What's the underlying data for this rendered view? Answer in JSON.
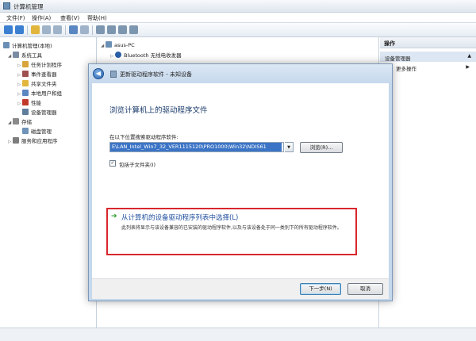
{
  "window": {
    "title": "计算机管理"
  },
  "menu": [
    "文件(F)",
    "操作(A)",
    "查看(V)",
    "帮助(H)"
  ],
  "tree": [
    {
      "label": "计算机管理(本地)",
      "indent": 0,
      "exp": "",
      "icon": "computer-icon",
      "color": "#6a8fb5"
    },
    {
      "label": "系统工具",
      "indent": 1,
      "exp": "◢",
      "icon": "tools-icon",
      "color": "#7b8da3"
    },
    {
      "label": "任务计划程序",
      "indent": 2,
      "exp": "▷",
      "icon": "clock-icon",
      "color": "#d9a43a"
    },
    {
      "label": "事件查看器",
      "indent": 2,
      "exp": "▷",
      "icon": "event-icon",
      "color": "#a05050"
    },
    {
      "label": "共享文件夹",
      "indent": 2,
      "exp": "▷",
      "icon": "folder-icon",
      "color": "#e2b63c"
    },
    {
      "label": "本地用户和组",
      "indent": 2,
      "exp": "▷",
      "icon": "users-icon",
      "color": "#5a86c1"
    },
    {
      "label": "性能",
      "indent": 2,
      "exp": "▷",
      "icon": "performance-icon",
      "color": "#c0392b"
    },
    {
      "label": "设备管理器",
      "indent": 2,
      "exp": "",
      "icon": "device-manager-icon",
      "color": "#607d9c"
    },
    {
      "label": "存储",
      "indent": 1,
      "exp": "◢",
      "icon": "storage-icon",
      "color": "#8a8a8a"
    },
    {
      "label": "磁盘管理",
      "indent": 2,
      "exp": "",
      "icon": "disk-icon",
      "color": "#6f93b9"
    },
    {
      "label": "服务和应用程序",
      "indent": 1,
      "exp": "▷",
      "icon": "services-icon",
      "color": "#7d7d7d"
    }
  ],
  "device_tree": [
    {
      "label": "asus-PC",
      "indent": 0,
      "exp": "◢",
      "icon": "computer-icon",
      "color": "#6a8fb5"
    },
    {
      "label": "Bluetooth 无线电收发器",
      "indent": 1,
      "exp": "▷",
      "icon": "bluetooth-icon",
      "color": "#2b5fa8"
    }
  ],
  "actions": {
    "header": "操作",
    "selected": "设备管理器",
    "more": "更多操作"
  },
  "dialog": {
    "title": "更新驱动程序软件 - 未知设备",
    "heading": "浏览计算机上的驱动程序文件",
    "search_label": "在以下位置搜索驱动程序软件:",
    "path": "E\\LAN_Intel_Win7_32_VER1115120\\PRO1000\\Win32\\NDIS61",
    "browse": "浏览(R)...",
    "include_subfolders": "包括子文件夹(I)",
    "include_checked": "✓",
    "link_title": "从计算机的设备驱动程序列表中选择(L)",
    "link_desc": "此列表将显示与该设备兼容的已安装的驱动程序软件,以及与该设备处于同一类别下的所有驱动程序软件。",
    "next": "下一步(N)",
    "cancel": "取消"
  }
}
